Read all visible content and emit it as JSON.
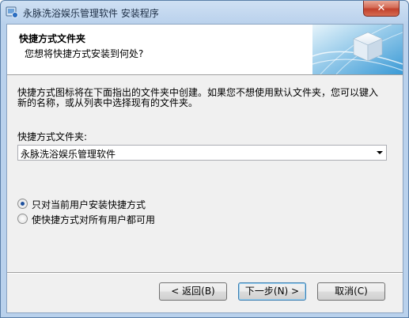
{
  "window": {
    "title": "永脉洗浴娱乐管理软件 安装程序"
  },
  "header": {
    "title": "快捷方式文件夹",
    "subtitle": "您想将快捷方式安装到何处?"
  },
  "body": {
    "description_line1": "快捷方式图标将在下面指出的文件夹中创建。如果您不想使用默认文件夹，您可以键入",
    "description_line2": "新的名称，或从列表中选择现有的文件夹。",
    "folder_label": "快捷方式文件夹:",
    "folder_value": "永脉洗浴娱乐管理软件"
  },
  "options": [
    {
      "label": "只对当前用户安装快捷方式",
      "checked": true
    },
    {
      "label": "使快捷方式对所有用户都可用",
      "checked": false
    }
  ],
  "buttons": {
    "back": "< 返回(B)",
    "next": "下一步(N) >",
    "cancel": "取消(C)"
  },
  "icons": {
    "close": "close-icon",
    "app": "installer-icon",
    "header": "cube-globe-graphic"
  }
}
